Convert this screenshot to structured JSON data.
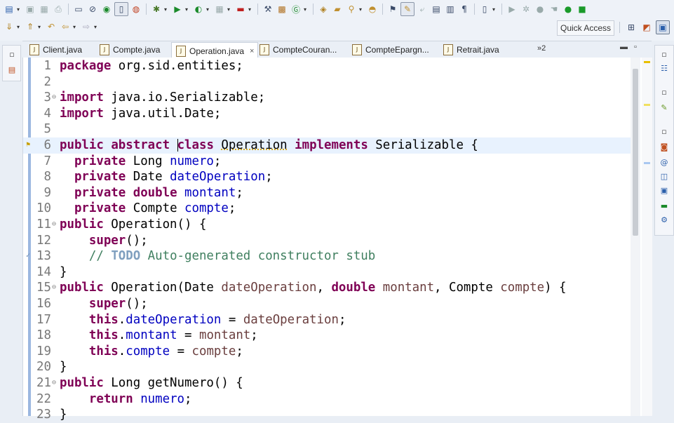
{
  "toolbar": {
    "quick_access": "Quick Access"
  },
  "tabs": [
    {
      "label": "Client.java",
      "active": false
    },
    {
      "label": "Compte.java",
      "active": false
    },
    {
      "label": "Operation.java",
      "active": true,
      "close": "×"
    },
    {
      "label": "CompteCouran...",
      "active": false
    },
    {
      "label": "CompteEpargn...",
      "active": false
    },
    {
      "label": "Retrait.java",
      "active": false
    }
  ],
  "tab_overflow": "»2",
  "editor": {
    "file": "Operation.java",
    "current_line": 6,
    "lines": [
      {
        "n": "1",
        "text": "package org.sid.entities;"
      },
      {
        "n": "2",
        "text": ""
      },
      {
        "n": "3",
        "text": "import java.io.Serializable;"
      },
      {
        "n": "4",
        "text": "import java.util.Date;"
      },
      {
        "n": "5",
        "text": ""
      },
      {
        "n": "6",
        "text": "public abstract class Operation implements Serializable {"
      },
      {
        "n": "7",
        "text": "  private Long numero;"
      },
      {
        "n": "8",
        "text": "  private Date dateOperation;"
      },
      {
        "n": "9",
        "text": "  private double montant;"
      },
      {
        "n": "10",
        "text": "  private Compte compte;"
      },
      {
        "n": "11",
        "text": "public Operation() {"
      },
      {
        "n": "12",
        "text": "    super();"
      },
      {
        "n": "13",
        "text": "    // TODO Auto-generated constructor stub"
      },
      {
        "n": "14",
        "text": "}"
      },
      {
        "n": "15",
        "text": "public Operation(Date dateOperation, double montant, Compte compte) {"
      },
      {
        "n": "16",
        "text": "    super();"
      },
      {
        "n": "17",
        "text": "    this.dateOperation = dateOperation;"
      },
      {
        "n": "18",
        "text": "    this.montant = montant;"
      },
      {
        "n": "19",
        "text": "    this.compte = compte;"
      },
      {
        "n": "20",
        "text": "}"
      },
      {
        "n": "21",
        "text": "public Long getNumero() {"
      },
      {
        "n": "22",
        "text": "    return numero;"
      },
      {
        "n": "23",
        "text": "}"
      }
    ]
  },
  "colors": {
    "keyword": "#7f0055",
    "field": "#0000c0",
    "comment": "#3f7f5f",
    "todo": "#7f9fbf",
    "current_line": "#e8f2fe"
  }
}
